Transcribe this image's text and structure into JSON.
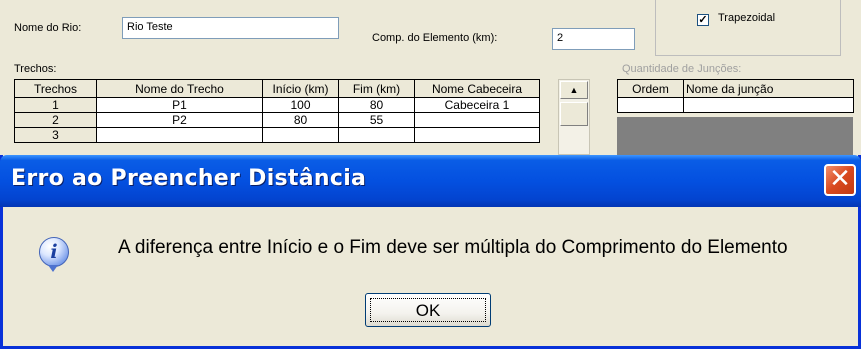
{
  "form": {
    "river_name_label": "Nome do Rio:",
    "river_name_value": "Rio Teste",
    "element_length_label": "Comp. do Elemento (km):",
    "element_length_value": "2",
    "trapezoidal_label": "Trapezoidal",
    "trapezoidal_checked": true,
    "trechos_label": "Trechos:",
    "junctions_count_label": "Quantidade de Junções:"
  },
  "trechos_table": {
    "headers": [
      "Trechos",
      "Nome do Trecho",
      "Início (km)",
      "Fim (km)",
      "Nome Cabeceira"
    ],
    "rows": [
      [
        "1",
        "P1",
        "100",
        "80",
        "Cabeceira 1"
      ],
      [
        "2",
        "P2",
        "80",
        "55",
        ""
      ],
      [
        "3",
        "",
        "",
        "",
        ""
      ]
    ]
  },
  "junctions_table": {
    "headers": [
      "Ordem",
      "Nome da junção"
    ]
  },
  "dialog": {
    "title": "Erro ao Preencher Distância",
    "message": "A diferença entre Início e o Fim deve ser múltipla do Comprimento do Elemento",
    "ok_label": "OK",
    "icon": "info-icon",
    "close_icon": "close-icon"
  },
  "colors": {
    "title_bar": "#0450e0",
    "window_bg": "#ece9d8",
    "close_button": "#d9491f"
  }
}
